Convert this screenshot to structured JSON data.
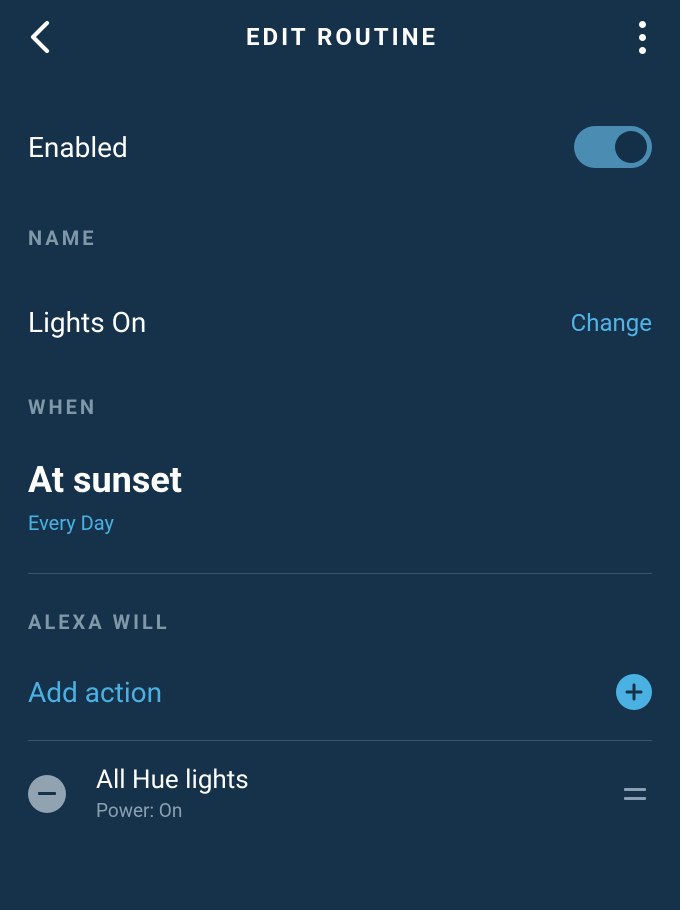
{
  "header": {
    "title": "EDIT ROUTINE"
  },
  "enabled": {
    "label": "Enabled",
    "value": true
  },
  "name_section": {
    "title": "NAME",
    "value": "Lights On",
    "change_label": "Change"
  },
  "when_section": {
    "title": "WHEN",
    "trigger": "At sunset",
    "recurrence": "Every Day"
  },
  "actions_section": {
    "title": "ALEXA WILL",
    "add_action_label": "Add action",
    "items": [
      {
        "title": "All Hue lights",
        "subtitle": "Power: On"
      }
    ]
  }
}
